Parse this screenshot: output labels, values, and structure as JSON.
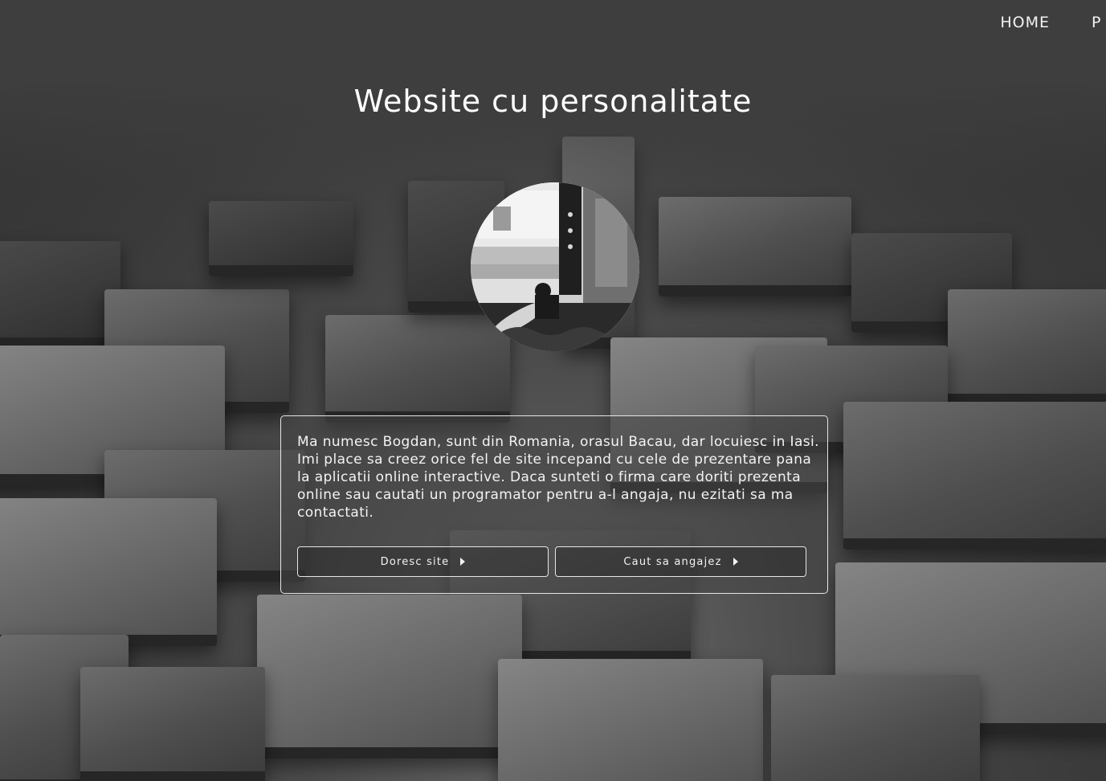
{
  "nav": {
    "items": [
      {
        "label": "HOME"
      },
      {
        "label": "P"
      }
    ]
  },
  "hero": {
    "title": "Website cu personalitate"
  },
  "about": {
    "text": "Ma numesc Bogdan, sunt din Romania, orasul Bacau, dar locuiesc in Iasi. Imi place sa creez orice fel de site incepand cu cele de prezentare pana la aplicatii online interactive. Daca sunteti o firma care doriti prezenta online sau cautati un programator pentru a-l angaja, nu ezitati sa ma contactati."
  },
  "buttons": {
    "want_site_label": "Doresc site",
    "hire_label": "Caut sa angajez",
    "icon": "caret-right-icon"
  },
  "colors": {
    "text": "#ffffff",
    "card_border": "#e6e6e6",
    "background": "#3c3c3c"
  }
}
